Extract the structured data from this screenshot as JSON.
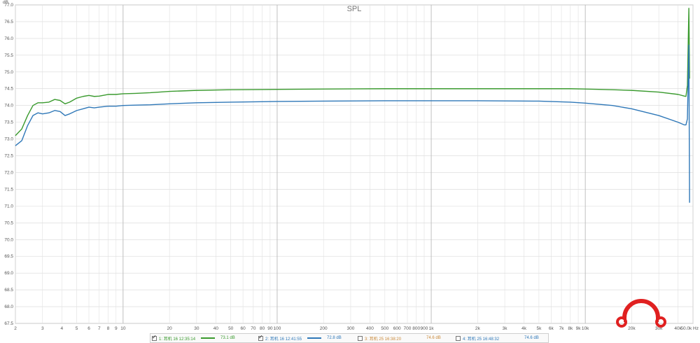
{
  "chart_data": {
    "type": "line",
    "title": "SPL",
    "ylabel": "dB",
    "xunit": "Hz",
    "xscale": "log",
    "xlim": [
      2,
      50000
    ],
    "ylim": [
      67.5,
      77.0
    ],
    "grid": true,
    "x_tick_labels": [
      {
        "v": 2,
        "t": "2"
      },
      {
        "v": 3,
        "t": "3"
      },
      {
        "v": 4,
        "t": "4"
      },
      {
        "v": 5,
        "t": "5"
      },
      {
        "v": 6,
        "t": "6"
      },
      {
        "v": 7,
        "t": "7"
      },
      {
        "v": 8,
        "t": "8"
      },
      {
        "v": 9,
        "t": "9"
      },
      {
        "v": 10,
        "t": "10"
      },
      {
        "v": 20,
        "t": "20"
      },
      {
        "v": 30,
        "t": "30"
      },
      {
        "v": 40,
        "t": "40"
      },
      {
        "v": 50,
        "t": "50"
      },
      {
        "v": 60,
        "t": "60"
      },
      {
        "v": 70,
        "t": "70"
      },
      {
        "v": 80,
        "t": "80"
      },
      {
        "v": 90,
        "t": "90"
      },
      {
        "v": 100,
        "t": "100"
      },
      {
        "v": 200,
        "t": "200"
      },
      {
        "v": 300,
        "t": "300"
      },
      {
        "v": 400,
        "t": "400"
      },
      {
        "v": 500,
        "t": "500"
      },
      {
        "v": 600,
        "t": "600"
      },
      {
        "v": 700,
        "t": "700"
      },
      {
        "v": 800,
        "t": "800"
      },
      {
        "v": 900,
        "t": "900"
      },
      {
        "v": 1000,
        "t": "1k"
      },
      {
        "v": 2000,
        "t": "2k"
      },
      {
        "v": 3000,
        "t": "3k"
      },
      {
        "v": 4000,
        "t": "4k"
      },
      {
        "v": 5000,
        "t": "5k"
      },
      {
        "v": 6000,
        "t": "6k"
      },
      {
        "v": 7000,
        "t": "7k"
      },
      {
        "v": 8000,
        "t": "8k"
      },
      {
        "v": 9000,
        "t": "9k"
      },
      {
        "v": 10000,
        "t": "10k"
      },
      {
        "v": 20000,
        "t": "20k"
      },
      {
        "v": 30000,
        "t": "30k"
      },
      {
        "v": 40000,
        "t": "40k"
      },
      {
        "v": 50000,
        "t": "50.0k Hz"
      }
    ],
    "y_ticks": [
      67.5,
      68.0,
      68.5,
      69.0,
      69.5,
      70.0,
      70.5,
      71.0,
      71.5,
      72.0,
      72.5,
      73.0,
      73.5,
      74.0,
      74.5,
      75.0,
      75.5,
      76.0,
      76.5,
      77.0
    ],
    "series": [
      {
        "name": "1: 耳机 16 12:35:14",
        "legend_value": "73.1 dB",
        "color": "#3a9a2e",
        "checked": true,
        "x": [
          2,
          2.2,
          2.4,
          2.6,
          2.8,
          3.0,
          3.3,
          3.6,
          3.9,
          4.2,
          4.5,
          5.0,
          5.5,
          6.0,
          6.5,
          7.0,
          8.0,
          8.5,
          9,
          10,
          12,
          15,
          20,
          30,
          50,
          100,
          200,
          500,
          1000,
          2000,
          5000,
          8000,
          10000,
          15000,
          20000,
          30000,
          40000,
          44000,
          45000,
          46000,
          47000,
          47500
        ],
        "y": [
          73.1,
          73.3,
          73.7,
          74.0,
          74.08,
          74.08,
          74.1,
          74.18,
          74.15,
          74.05,
          74.1,
          74.22,
          74.27,
          74.3,
          74.27,
          74.28,
          74.33,
          74.33,
          74.33,
          74.35,
          74.36,
          74.38,
          74.42,
          74.45,
          74.47,
          74.48,
          74.49,
          74.5,
          74.5,
          74.5,
          74.5,
          74.5,
          74.49,
          74.47,
          74.45,
          74.4,
          74.33,
          74.28,
          74.27,
          74.6,
          76.9,
          74.8
        ]
      },
      {
        "name": "2: 耳机 16 12:41:55",
        "legend_value": "72.8 dB",
        "color": "#2f78b8",
        "checked": true,
        "x": [
          2,
          2.2,
          2.4,
          2.6,
          2.8,
          3.0,
          3.3,
          3.6,
          3.9,
          4.2,
          4.5,
          5.0,
          5.5,
          6.0,
          6.5,
          7.0,
          8.0,
          8.5,
          9,
          10,
          12,
          15,
          20,
          30,
          50,
          100,
          200,
          500,
          1000,
          2000,
          5000,
          8000,
          10000,
          15000,
          20000,
          30000,
          40000,
          44000,
          45000,
          46000,
          47000,
          47500
        ],
        "y": [
          72.8,
          72.95,
          73.4,
          73.7,
          73.78,
          73.75,
          73.78,
          73.85,
          73.82,
          73.7,
          73.75,
          73.85,
          73.9,
          73.95,
          73.93,
          73.95,
          73.98,
          73.98,
          73.98,
          74.0,
          74.01,
          74.02,
          74.05,
          74.08,
          74.1,
          74.12,
          74.13,
          74.14,
          74.14,
          74.14,
          74.13,
          74.1,
          74.07,
          74.0,
          73.9,
          73.7,
          73.5,
          73.42,
          73.42,
          73.6,
          75.8,
          71.1
        ]
      },
      {
        "name": "3: 耳机 25 16:38:20",
        "legend_value": "74.6 dB",
        "color": "#c9893a",
        "checked": false
      },
      {
        "name": "4: 耳机 25 16:48:32",
        "legend_value": "74.6 dB",
        "color": "#2f78b8",
        "checked": false
      }
    ]
  },
  "logo": {
    "brand_color": "#e02020"
  }
}
